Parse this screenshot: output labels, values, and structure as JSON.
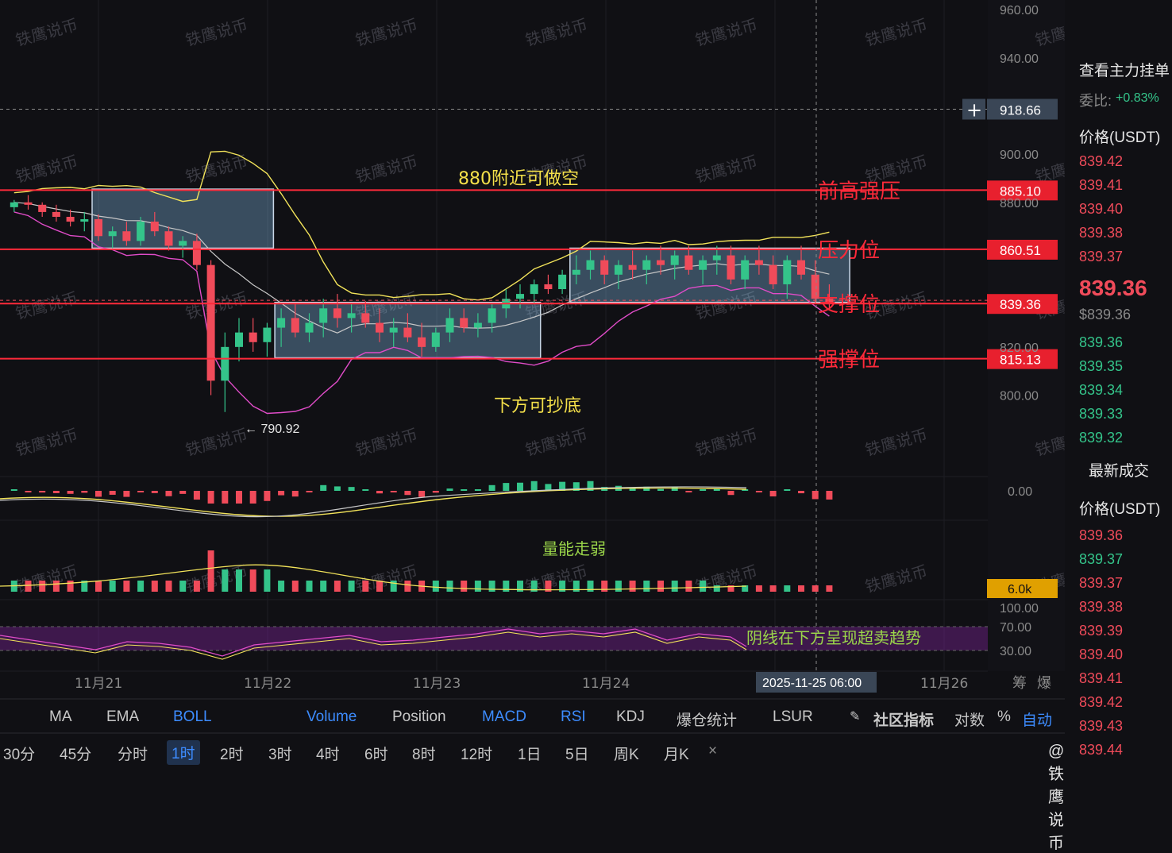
{
  "chart_data": {
    "type": "candlestick",
    "price_axis": {
      "ticks": [
        "960.00",
        "940.00",
        "918.66",
        "900.00",
        "880.00",
        "820.00",
        "800.00"
      ],
      "ylim": [
        786,
        962
      ]
    },
    "x_axis": {
      "ticks": [
        "11月21",
        "11月22",
        "11月23",
        "11月24",
        "11月26"
      ],
      "crosshair_label": "2025-11-25 06:00"
    },
    "low_label": "790.92",
    "crosshair_price": "918.66",
    "levels": [
      {
        "price": 885.1,
        "label": "前高强压",
        "tag": "885.10"
      },
      {
        "price": 860.51,
        "label": "压力位",
        "tag": "860.51"
      },
      {
        "price": 838.0,
        "label": "支撑位",
        "tag": "839.36"
      },
      {
        "price": 815.13,
        "label": "强撑位",
        "tag": "815.13"
      }
    ],
    "annotations": {
      "top_note": "880附近可做空",
      "bottom_note": "下方可抄底",
      "volume_note": "量能走弱",
      "rsi_note": "阴线在下方呈现超卖趋势"
    },
    "macd_axis": "0.00",
    "volume_tag": "6.0k",
    "rsi_axis": [
      "100.00",
      "70.00",
      "30.00"
    ],
    "boxes": [
      {
        "x0": 0,
        "x1": 12,
        "top": 885.5,
        "bottom": 861
      },
      {
        "x0": 13,
        "x1": 31,
        "top": 838.5,
        "bottom": 815.5
      },
      {
        "x0": 34,
        "x1": 53,
        "top": 861,
        "bottom": 838.5
      }
    ],
    "candles": [
      [
        -6,
        878,
        881,
        876,
        880
      ],
      [
        -5,
        880,
        883,
        877,
        879
      ],
      [
        -4,
        879,
        880,
        874,
        876
      ],
      [
        -3,
        876,
        879,
        872,
        874
      ],
      [
        -2,
        874,
        877,
        870,
        872
      ],
      [
        -1,
        872,
        876,
        868,
        873
      ],
      [
        0,
        873,
        875,
        864,
        866
      ],
      [
        1,
        866,
        870,
        861,
        868
      ],
      [
        2,
        868,
        872,
        862,
        864
      ],
      [
        3,
        864,
        874,
        862,
        872
      ],
      [
        4,
        872,
        876,
        866,
        868
      ],
      [
        5,
        868,
        870,
        860,
        862
      ],
      [
        6,
        862,
        866,
        857,
        864
      ],
      [
        7,
        864,
        867,
        852,
        854
      ],
      [
        8,
        854,
        856,
        800,
        806
      ],
      [
        9,
        806,
        826,
        793,
        820
      ],
      [
        10,
        820,
        832,
        814,
        826
      ],
      [
        11,
        826,
        832,
        818,
        822
      ],
      [
        12,
        822,
        830,
        816,
        828
      ],
      [
        13,
        828,
        836,
        820,
        832
      ],
      [
        14,
        832,
        838,
        824,
        826
      ],
      [
        15,
        826,
        834,
        822,
        830
      ],
      [
        16,
        830,
        840,
        824,
        836
      ],
      [
        17,
        836,
        842,
        828,
        832
      ],
      [
        18,
        832,
        838,
        826,
        834
      ],
      [
        19,
        834,
        839,
        828,
        830
      ],
      [
        20,
        830,
        836,
        822,
        826
      ],
      [
        21,
        826,
        832,
        820,
        828
      ],
      [
        22,
        828,
        834,
        822,
        824
      ],
      [
        23,
        824,
        830,
        816,
        820
      ],
      [
        24,
        820,
        828,
        818,
        826
      ],
      [
        25,
        826,
        836,
        822,
        832
      ],
      [
        26,
        832,
        836,
        826,
        828
      ],
      [
        27,
        828,
        834,
        824,
        830
      ],
      [
        28,
        830,
        838,
        826,
        836
      ],
      [
        29,
        836,
        844,
        832,
        840
      ],
      [
        30,
        840,
        846,
        836,
        842
      ],
      [
        31,
        842,
        848,
        838,
        846
      ],
      [
        32,
        846,
        850,
        842,
        844
      ],
      [
        33,
        844,
        852,
        842,
        850
      ],
      [
        34,
        850,
        858,
        846,
        852
      ],
      [
        35,
        852,
        860,
        848,
        856
      ],
      [
        36,
        856,
        858,
        846,
        850
      ],
      [
        37,
        850,
        856,
        844,
        854
      ],
      [
        38,
        854,
        860,
        848,
        852
      ],
      [
        39,
        852,
        858,
        846,
        856
      ],
      [
        40,
        856,
        862,
        850,
        854
      ],
      [
        41,
        854,
        860,
        848,
        858
      ],
      [
        42,
        858,
        862,
        850,
        852
      ],
      [
        43,
        852,
        858,
        846,
        856
      ],
      [
        44,
        856,
        862,
        850,
        858
      ],
      [
        45,
        858,
        862,
        846,
        848
      ],
      [
        46,
        848,
        858,
        844,
        856
      ],
      [
        47,
        856,
        862,
        850,
        854
      ],
      [
        48,
        854,
        858,
        844,
        846
      ],
      [
        49,
        846,
        858,
        840,
        856
      ],
      [
        50,
        856,
        862,
        848,
        850
      ],
      [
        51,
        850,
        856,
        838,
        840
      ],
      [
        52,
        840,
        846,
        836,
        838
      ]
    ]
  },
  "side_panel": {
    "title": "查看主力挂单",
    "ratio_label": "委比:",
    "ratio_value": "+0.83%",
    "price_header": "价格(USDT)",
    "asks": [
      "839.42",
      "839.41",
      "839.40",
      "839.38",
      "839.37"
    ],
    "last_price": "839.36",
    "last_sub": "$839.36",
    "bids": [
      "839.36",
      "839.35",
      "839.34",
      "839.33",
      "839.32"
    ],
    "trades_title": "最新成交",
    "trades_header": "价格(USDT)",
    "trades": [
      {
        "p": "839.36",
        "c": "red"
      },
      {
        "p": "839.37",
        "c": "green"
      },
      {
        "p": "839.37",
        "c": "red"
      },
      {
        "p": "839.38",
        "c": "red"
      },
      {
        "p": "839.39",
        "c": "red"
      },
      {
        "p": "839.40",
        "c": "red"
      },
      {
        "p": "839.41",
        "c": "red"
      },
      {
        "p": "839.42",
        "c": "red"
      },
      {
        "p": "839.43",
        "c": "red"
      },
      {
        "p": "839.44",
        "c": "red"
      }
    ]
  },
  "indicator_bar": {
    "items": [
      "MA",
      "EMA",
      "BOLL",
      "Volume",
      "Position",
      "MACD",
      "RSI",
      "KDJ",
      "爆仓统计",
      "LSUR",
      "社区指标",
      "对数",
      "%",
      "自动"
    ],
    "right_labels": [
      "筹",
      "爆"
    ]
  },
  "interval_bar": {
    "items": [
      "30分",
      "45分",
      "分时",
      "1时",
      "2时",
      "3时",
      "4时",
      "6时",
      "8时",
      "12时",
      "1日",
      "5日",
      "周K",
      "月K",
      "×"
    ],
    "active": "1时"
  },
  "watermark": "铁鹰说币",
  "brand": "@铁鹰说币",
  "colors": {
    "up": "#34c48a",
    "down": "#f04b5a",
    "level": "#ff2a3a",
    "box": "#7fb2d9",
    "boll_upper": "#f2e35a",
    "boll_mid": "#c8c8c8",
    "boll_lower": "#e04cc8",
    "tag_bg": "#e8202e",
    "vol_tag": "#e0a000"
  }
}
